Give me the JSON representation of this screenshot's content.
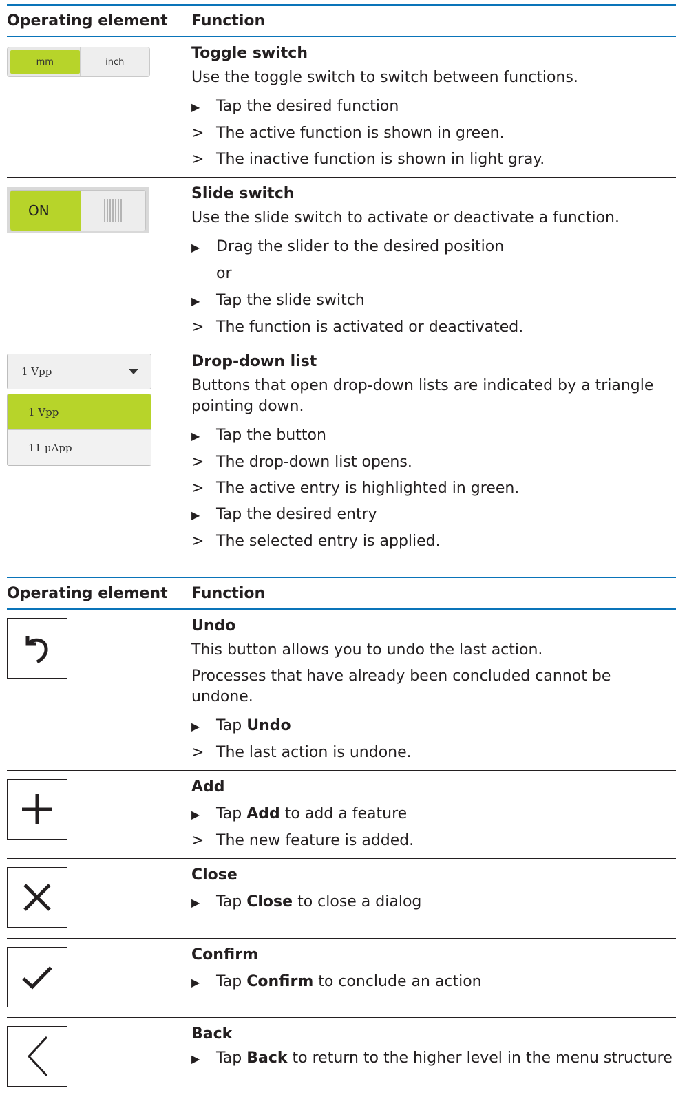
{
  "table1": {
    "header": {
      "col1": "Operating element",
      "col2": "Function"
    },
    "toggle": {
      "widget": {
        "option_active": "mm",
        "option_inactive": "inch",
        "active_color": "#b7d42a"
      },
      "title": "Toggle switch",
      "text": "Use the toggle switch to switch between functions.",
      "steps": [
        {
          "kind": "action",
          "text": "Tap the desired function"
        },
        {
          "kind": "result",
          "text": "The active function is shown in green."
        },
        {
          "kind": "result",
          "text": "The inactive function is shown in light gray."
        }
      ]
    },
    "slide": {
      "widget": {
        "label": "ON"
      },
      "title": "Slide switch",
      "text": "Use the slide switch to activate or deactivate a function.",
      "steps": [
        {
          "kind": "action",
          "text": "Drag the slider to the desired position"
        },
        {
          "kind": "continuation",
          "text": "or"
        },
        {
          "kind": "action",
          "text": "Tap the slide switch"
        },
        {
          "kind": "result",
          "text": "The function is activated or deactivated."
        }
      ]
    },
    "dropdown": {
      "widget": {
        "selected": "1 Vpp",
        "options": [
          "1 Vpp",
          "11 µApp"
        ]
      },
      "title": "Drop-down list",
      "text": "Buttons that open drop-down lists are indicated by a triangle pointing down.",
      "steps": [
        {
          "kind": "action",
          "text": "Tap the button"
        },
        {
          "kind": "result",
          "text": "The drop-down list opens."
        },
        {
          "kind": "result",
          "text": "The active entry is highlighted in green."
        },
        {
          "kind": "action",
          "text": "Tap the desired entry"
        },
        {
          "kind": "result",
          "text": "The selected entry is applied."
        }
      ]
    }
  },
  "table2": {
    "header": {
      "col1": "Operating element",
      "col2": "Function"
    },
    "undo": {
      "icon": "undo-icon",
      "title": "Undo",
      "text1": "This button allows you to undo the last action.",
      "text2": "Processes that have already been concluded cannot be undone.",
      "step1": {
        "pre": "Tap ",
        "bold": "Undo",
        "post": ""
      },
      "result1": "The last action is undone."
    },
    "add": {
      "icon": "plus-icon",
      "title": "Add",
      "step1": {
        "pre": "Tap ",
        "bold": "Add",
        "post": " to add a feature"
      },
      "result1": "The new feature is added."
    },
    "close": {
      "icon": "close-icon",
      "title": "Close",
      "step1": {
        "pre": "Tap ",
        "bold": "Close",
        "post": " to close a dialog"
      }
    },
    "confirm": {
      "icon": "checkmark-icon",
      "title": "Confirm",
      "step1": {
        "pre": "Tap ",
        "bold": "Confirm",
        "post": " to conclude an action"
      }
    },
    "back": {
      "icon": "chevron-left-icon",
      "title": "Back",
      "step1": {
        "pre": "Tap ",
        "bold": "Back",
        "post": " to return to the higher level in the menu structure"
      }
    }
  },
  "markers": {
    "action": "▶",
    "result": ">"
  }
}
